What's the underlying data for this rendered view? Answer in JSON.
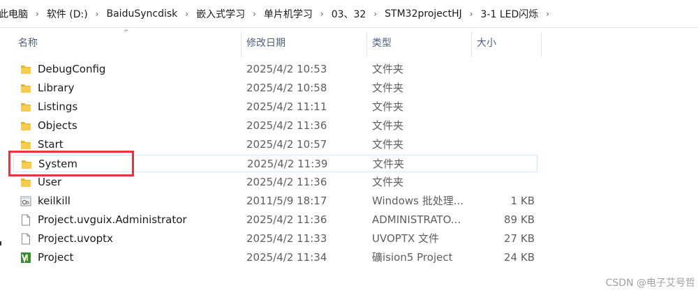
{
  "breadcrumb": [
    "此电脑",
    "软件 (D:)",
    "BaiduSyncdisk",
    "嵌入式学习",
    "单片机学习",
    "03、32",
    "STM32projectHJ",
    "3-1 LED闪烁"
  ],
  "breadcrumb_separator": "›",
  "columns": {
    "name": "名称",
    "date": "修改日期",
    "type": "类型",
    "size": "大小"
  },
  "sort_indicator": "^",
  "files": [
    {
      "name": "DebugConfig",
      "date": "2025/4/2 10:53",
      "type": "文件夹",
      "size": "",
      "icon": "folder-icon"
    },
    {
      "name": "Library",
      "date": "2025/4/2 10:58",
      "type": "文件夹",
      "size": "",
      "icon": "folder-icon"
    },
    {
      "name": "Listings",
      "date": "2025/4/2 11:11",
      "type": "文件夹",
      "size": "",
      "icon": "folder-icon"
    },
    {
      "name": "Objects",
      "date": "2025/4/2 11:36",
      "type": "文件夹",
      "size": "",
      "icon": "folder-icon"
    },
    {
      "name": "Start",
      "date": "2025/4/2 10:57",
      "type": "文件夹",
      "size": "",
      "icon": "folder-icon"
    },
    {
      "name": "System",
      "date": "2025/4/2 11:39",
      "type": "文件夹",
      "size": "",
      "icon": "folder-icon",
      "selected": true
    },
    {
      "name": "User",
      "date": "2025/4/2 11:36",
      "type": "文件夹",
      "size": "",
      "icon": "folder-icon"
    },
    {
      "name": "keilkill",
      "date": "2011/5/9 18:17",
      "type": "Windows 批处理...",
      "size": "1 KB",
      "icon": "batch-file-icon"
    },
    {
      "name": "Project.uvguix.Administrator",
      "date": "2025/4/2 11:36",
      "type": "ADMINISTRATO...",
      "size": "89 KB",
      "icon": "document-icon"
    },
    {
      "name": "Project.uvoptx",
      "date": "2025/4/2 11:33",
      "type": "UVOPTX 文件",
      "size": "27 KB",
      "icon": "document-icon"
    },
    {
      "name": "Project",
      "date": "2025/4/2 11:34",
      "type": "礦ision5 Project",
      "size": "24 KB",
      "icon": "keil-project-icon"
    }
  ],
  "watermark": "CSDN @电子艾号哲",
  "colors": {
    "highlight": "#e8353b",
    "selection_border": "#cde8ff",
    "header_text": "#4d6082",
    "folder": "#f5c33b"
  }
}
